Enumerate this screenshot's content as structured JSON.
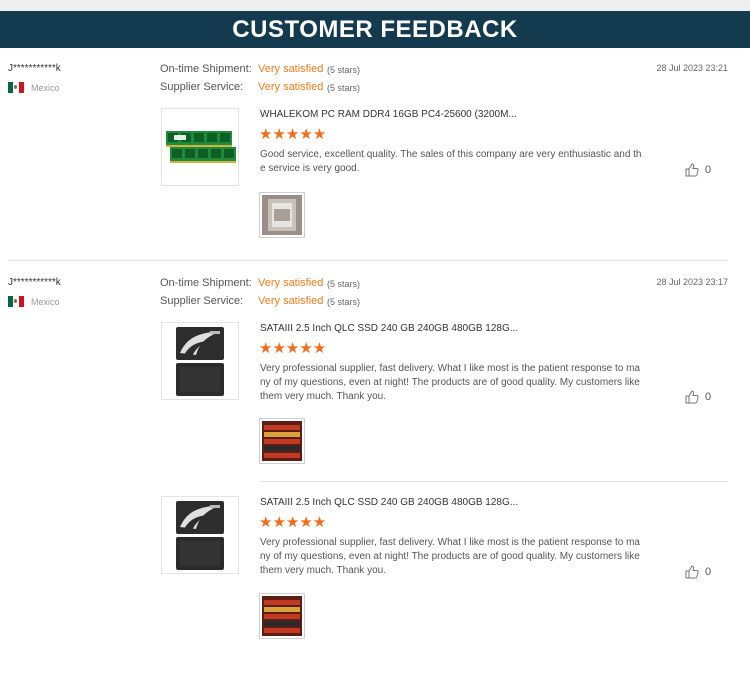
{
  "header": {
    "title": "CUSTOMER FEEDBACK"
  },
  "labels": {
    "ontime": "On-time Shipment:",
    "supplier": "Supplier Service:"
  },
  "reviews": [
    {
      "reviewer": "J***********k",
      "country": "Mexico",
      "date": "28 Jul 2023 23:21",
      "ontime_value": "Very satisfied",
      "ontime_stars": "(5 stars)",
      "supplier_value": "Very satisfied",
      "supplier_stars": "(5 stars)",
      "items": [
        {
          "product": "WHALEKOM PC RAM DDR4 16GB PC4-25600 (3200M...",
          "rating": 5,
          "text": "Good service, excellent quality. The sales of this company are very enthusiastic and the service is very good.",
          "likes": "0",
          "thumb_icon": "ram-module-icon"
        }
      ]
    },
    {
      "reviewer": "J***********k",
      "country": "Mexico",
      "date": "28 Jul 2023 23:17",
      "ontime_value": "Very satisfied",
      "ontime_stars": "(5 stars)",
      "supplier_value": "Very satisfied",
      "supplier_stars": "(5 stars)",
      "items": [
        {
          "product": "SATAIII 2.5 Inch QLC SSD 240 GB 240GB 480GB 128G...",
          "rating": 5,
          "text": "Very professional supplier, fast delivery. What I like most is the patient response to many of my questions, even at night! The products are of good quality. My customers like them very much. Thank you.",
          "likes": "0",
          "thumb_icon": "ssd-drive-icon"
        },
        {
          "product": "SATAIII 2.5 Inch QLC SSD 240 GB 240GB 480GB 128G...",
          "rating": 5,
          "text": "Very professional supplier, fast delivery. What I like most is the patient response to many of my questions, even at night! The products are of good quality. My customers like them very much. Thank you.",
          "likes": "0",
          "thumb_icon": "ssd-drive-icon"
        }
      ]
    }
  ],
  "star_glyphs": "★★★★★",
  "colors": {
    "banner": "#143a4f",
    "accent_orange": "#f07c1e",
    "star": "#f26c1a"
  }
}
